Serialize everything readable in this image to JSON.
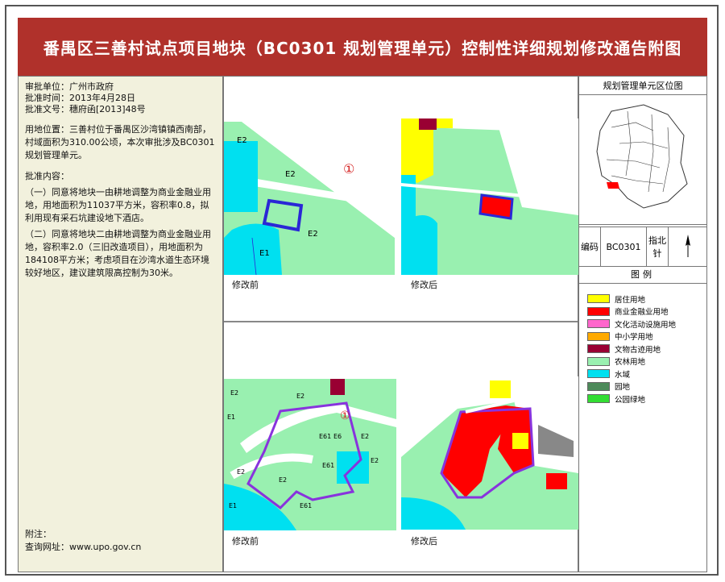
{
  "title": "番禺区三善村试点项目地块（BC0301 规划管理单元）控制性详细规划修改通告附图",
  "info": {
    "approver": "审批单位：广州市政府",
    "date": "批准时间：2013年4月28日",
    "doc": "批准文号：穗府函[2013]48号",
    "location": "用地位置：三善村位于番禺区沙湾镇镇西南部，村域面积为310.00公顷，本次审批涉及BC0301规划管理单元。",
    "content_title": "批准内容：",
    "item1": "（一）同意将地块一由耕地调整为商业金融业用地，用地面积为11037平方米，容积率0.8，拟利用现有采石坑建设地下酒店。",
    "item2": "（二）同意将地块二由耕地调整为商业金融业用地，容积率2.0（三旧改造项目），用地面积为184108平方米；考虑项目在沙湾水道生态环境较好地区，建议建筑限高控制为30米。",
    "note": "附注：",
    "website": "查询网址：www.upo.gov.cn"
  },
  "maps": {
    "before_label": "修改前",
    "after_label": "修改后",
    "plot1_marker": "①",
    "plot2_marker": "①",
    "top_labels": [
      "E2",
      "E2",
      "E2",
      "E1"
    ],
    "bottom_labels": [
      "E2",
      "E2",
      "E1",
      "E2",
      "E61",
      "E6",
      "E2",
      "E61",
      "E2",
      "E1",
      "E61",
      "E2"
    ]
  },
  "right": {
    "location_title": "规划管理单元区位图",
    "code_label": "编码",
    "code_value": "BC0301",
    "north_label": "指北针",
    "legend_title": "图例",
    "legend": [
      {
        "label": "居住用地",
        "color": "#ffff00"
      },
      {
        "label": "商业金融业用地",
        "color": "#ff0000"
      },
      {
        "label": "文化活动设施用地",
        "color": "#ff66cc"
      },
      {
        "label": "中小学用地",
        "color": "#ffaa00"
      },
      {
        "label": "文物古迹用地",
        "color": "#990033"
      },
      {
        "label": "农林用地",
        "color": "#99f0b0"
      },
      {
        "label": "水域",
        "color": "#00e0f0"
      },
      {
        "label": "园地",
        "color": "#4d8a5a"
      },
      {
        "label": "公园绿地",
        "color": "#33dd33"
      }
    ]
  }
}
